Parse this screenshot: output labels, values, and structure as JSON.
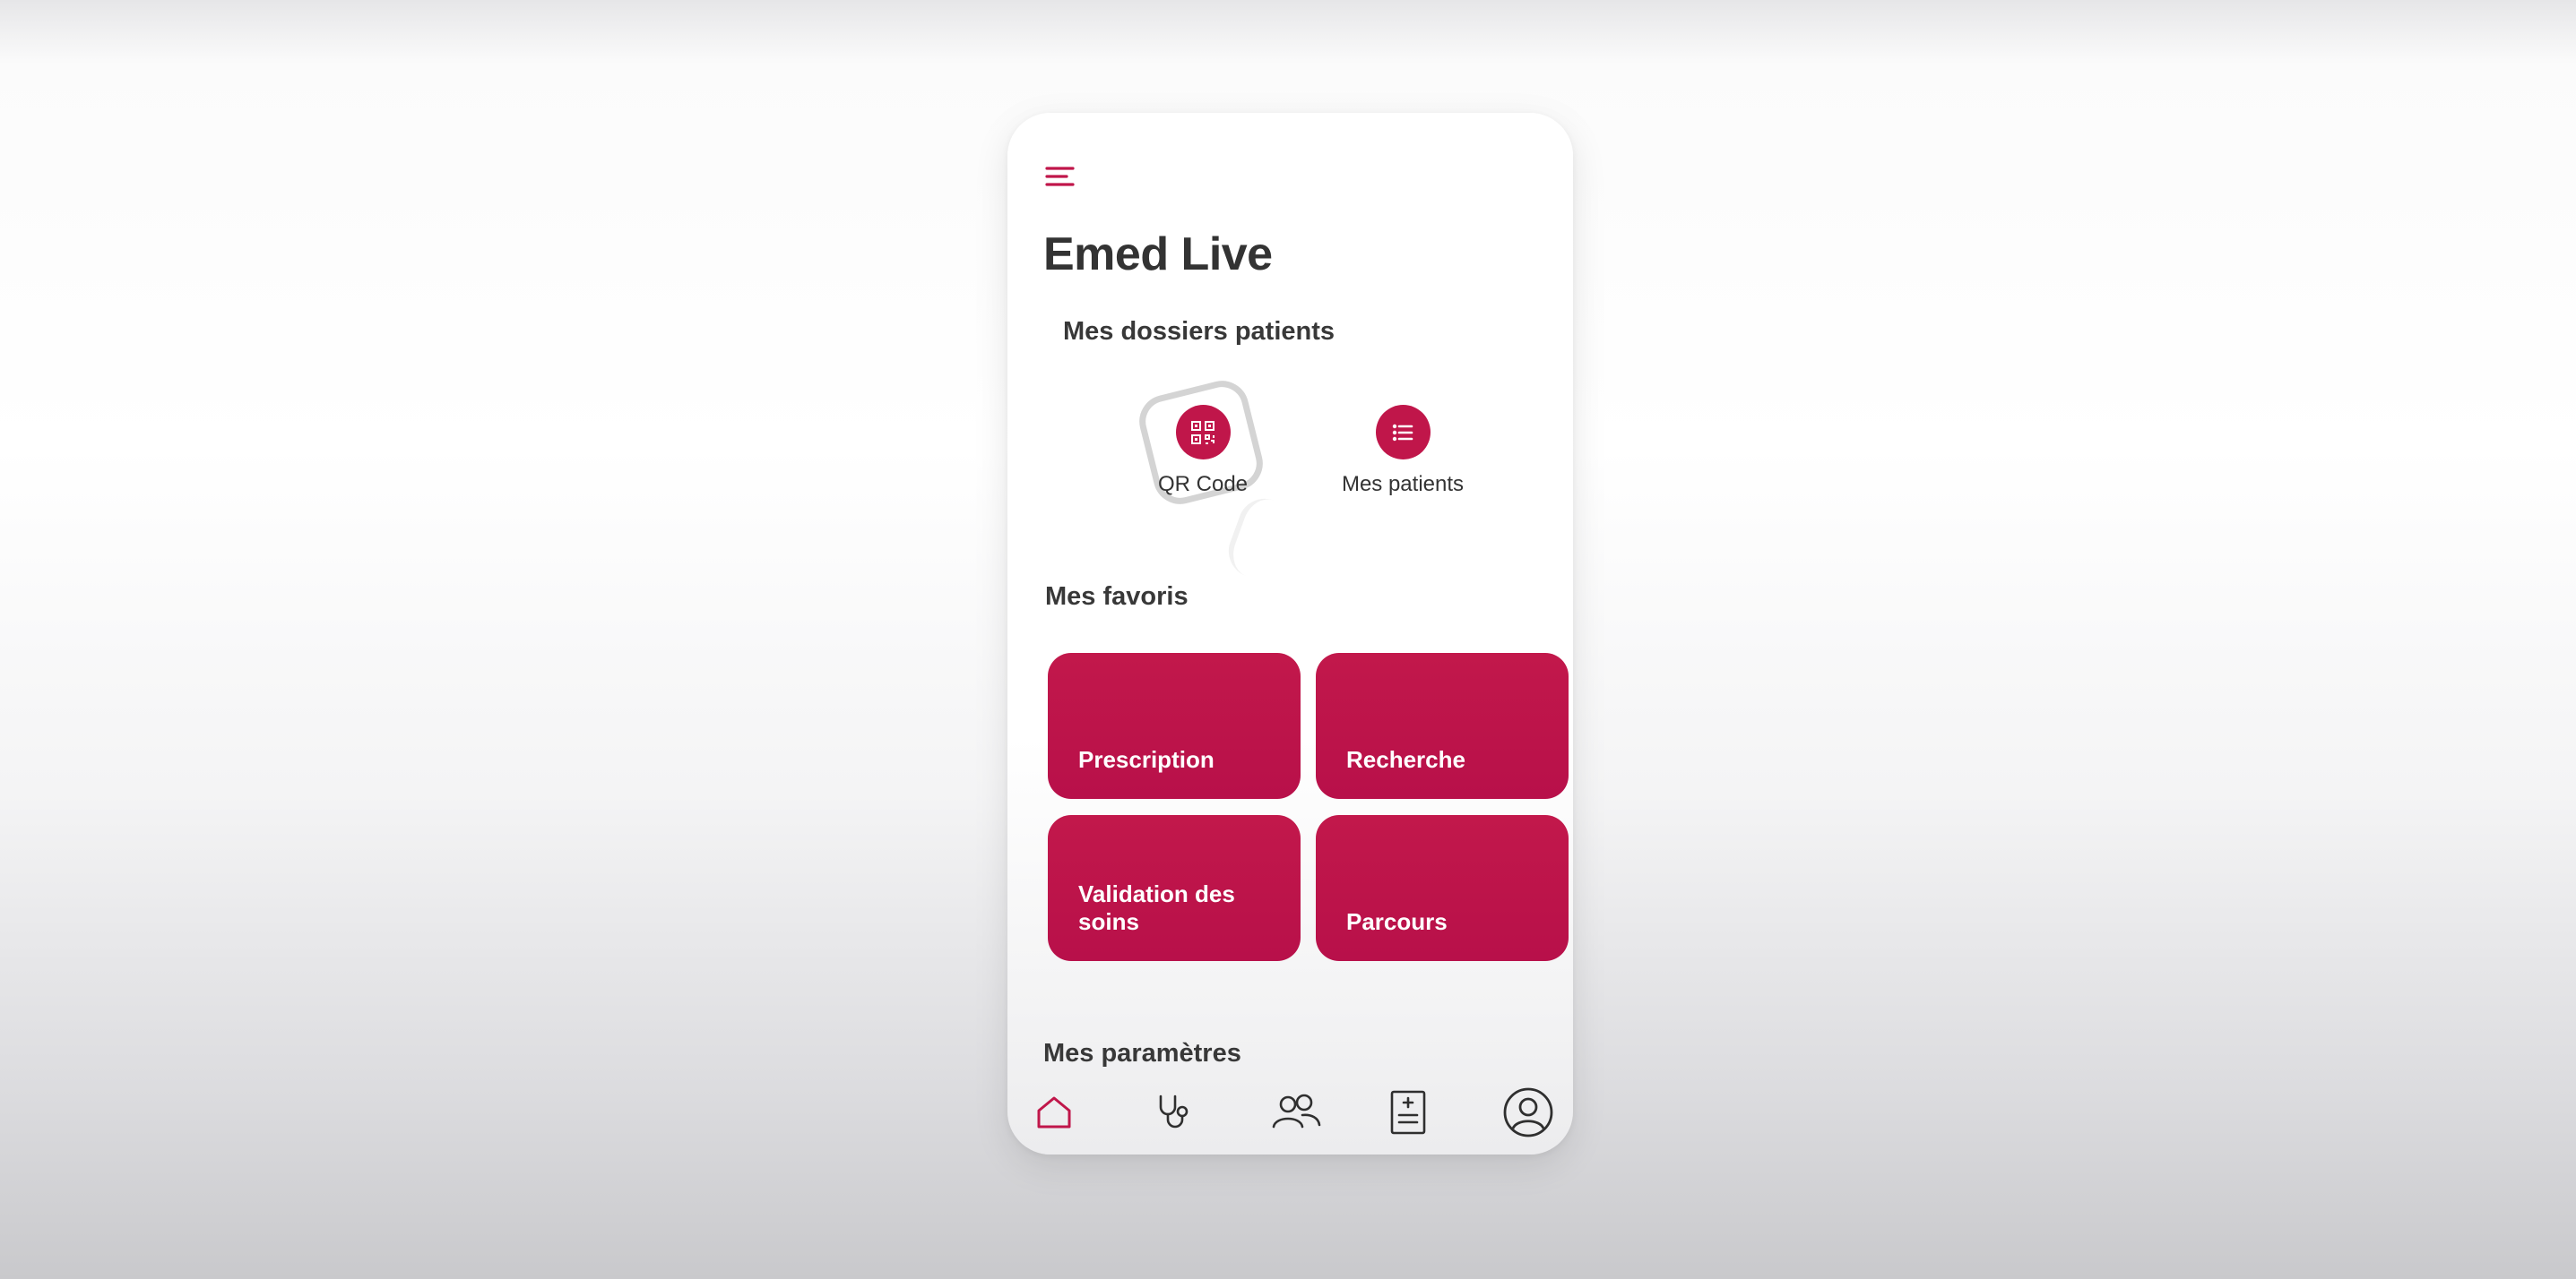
{
  "app": {
    "title": "Emed Live"
  },
  "icons": {
    "menu": "hamburger-menu-icon",
    "qr": "qr-code-icon",
    "list": "list-icon",
    "home": "home-icon",
    "stethoscope": "stethoscope-icon",
    "team": "users-icon",
    "document": "medical-document-icon",
    "profile": "user-profile-icon"
  },
  "colors": {
    "accent": "#c0164a",
    "text": "#333333",
    "nav_inactive": "#2f2f2f"
  },
  "dossiers": {
    "title": "Mes dossiers patients",
    "actions": [
      {
        "label": "QR Code"
      },
      {
        "label": "Mes patients"
      }
    ]
  },
  "favoris": {
    "title": "Mes favoris",
    "cards": [
      {
        "label": "Prescription"
      },
      {
        "label": "Recherche"
      },
      {
        "label": "Validation des soins"
      },
      {
        "label": "Parcours"
      }
    ]
  },
  "parametres": {
    "title": "Mes paramètres"
  },
  "bottom_nav": {
    "active": "home"
  }
}
